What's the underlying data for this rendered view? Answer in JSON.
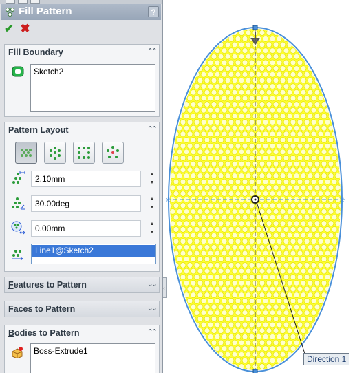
{
  "property_manager": {
    "title": "Fill Pattern",
    "help_label": "?",
    "ok_icon": "checkmark-icon",
    "cancel_icon": "x-icon",
    "sections": {
      "fill_boundary": {
        "title_first": "F",
        "title_rest": "ill Boundary",
        "items": [
          "Sketch2"
        ],
        "chevron": "⌃⌃"
      },
      "pattern_layout": {
        "title": "Pattern Layout",
        "chevron": "⌃⌃",
        "layouts": [
          "perforation-layout",
          "circular-layout",
          "square-layout",
          "polygon-layout"
        ],
        "spacing": "2.10mm",
        "angle": "30.00deg",
        "margin": "0.00mm",
        "direction": "Line1@Sketch2"
      },
      "features_to_pattern": {
        "title_first": "F",
        "title_rest": "eatures to Pattern",
        "chevron": "⌄⌄"
      },
      "faces_to_pattern": {
        "title_first": "F",
        "title_mid": "aces to Pattern",
        "chevron": "⌄⌄"
      },
      "bodies_to_pattern": {
        "title_first": "B",
        "title_rest": "odies to Pattern",
        "chevron": "⌃⌃",
        "items": [
          "Boss-Extrude1"
        ]
      }
    }
  },
  "viewport": {
    "callout_label": "Direction 1",
    "fill_color": "#ffff33",
    "outline_color": "#4a90d9"
  }
}
